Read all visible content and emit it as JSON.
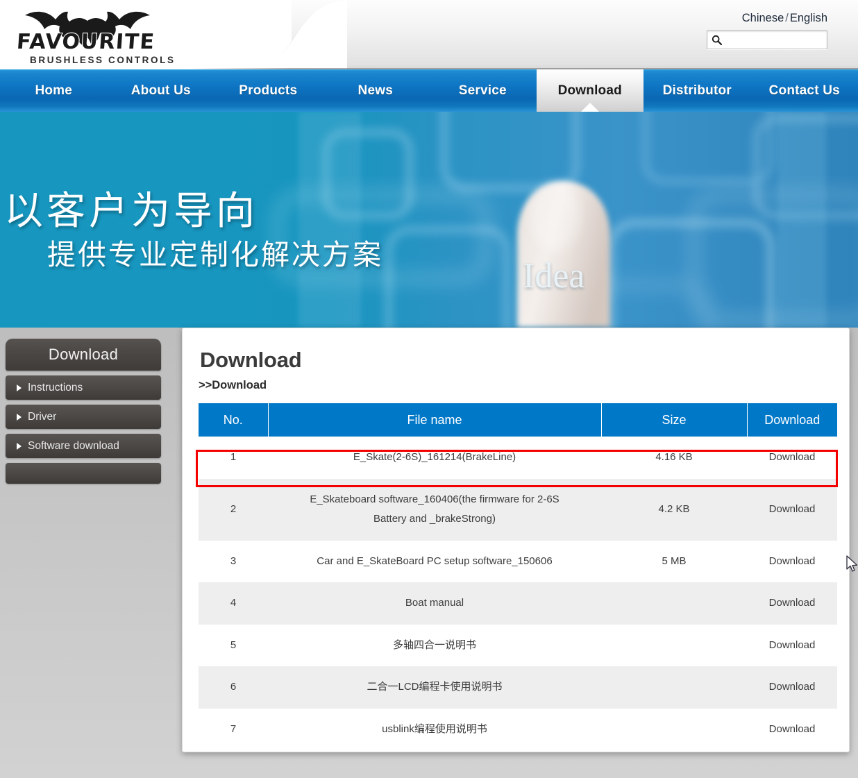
{
  "header": {
    "logo": {
      "brand": "FAVOURITE",
      "tagline": "BRUSHLESS CONTROLS",
      "icon": "bat-logo-icon"
    },
    "lang_chinese": "Chinese",
    "lang_separator": "/",
    "lang_english": "English",
    "search": {
      "placeholder": "",
      "value": "",
      "icon": "search-icon"
    }
  },
  "nav": {
    "items": [
      {
        "label": "Home",
        "active": false
      },
      {
        "label": "About Us",
        "active": false
      },
      {
        "label": "Products",
        "active": false
      },
      {
        "label": "News",
        "active": false
      },
      {
        "label": "Service",
        "active": false
      },
      {
        "label": "Download",
        "active": true
      },
      {
        "label": "Distributor",
        "active": false
      },
      {
        "label": "Contact Us",
        "active": false
      }
    ]
  },
  "banner": {
    "title": "以客户为导向",
    "subtitle": "提供专业定制化解决方案",
    "overlay_word": "Idea",
    "accent_color": "#1494bd"
  },
  "sidebar": {
    "heading": "Download",
    "items": [
      {
        "label": "Instructions"
      },
      {
        "label": "Driver"
      },
      {
        "label": "Software download"
      },
      {
        "label": ""
      }
    ]
  },
  "content": {
    "page_title": "Download",
    "breadcrumb": ">>Download",
    "table": {
      "header_color": "#0078c8",
      "columns": [
        "No.",
        "File name",
        "Size",
        "Download"
      ],
      "rows": [
        {
          "no": "1",
          "name": "E_Skate(2-6S)_161214(BrakeLine)",
          "size": "4.16 KB",
          "action": "Download",
          "highlighted": true
        },
        {
          "no": "2",
          "name": "E_Skateboard software_160406(the firmware for 2-6S Battery and _brakeStrong)",
          "size": "4.2 KB",
          "action": "Download",
          "highlighted": false
        },
        {
          "no": "3",
          "name": "Car and E_SkateBoard PC setup software_150606",
          "size": "5 MB",
          "action": "Download",
          "highlighted": false
        },
        {
          "no": "4",
          "name": "Boat manual",
          "size": "",
          "action": "Download",
          "highlighted": false
        },
        {
          "no": "5",
          "name": "多轴四合一说明书",
          "size": "",
          "action": "Download",
          "highlighted": false
        },
        {
          "no": "6",
          "name": "二合一LCD编程卡使用说明书",
          "size": "",
          "action": "Download",
          "highlighted": false
        },
        {
          "no": "7",
          "name": "usblink编程使用说明书",
          "size": "",
          "action": "Download",
          "highlighted": false
        }
      ]
    },
    "highlight_color": "#f40000"
  }
}
